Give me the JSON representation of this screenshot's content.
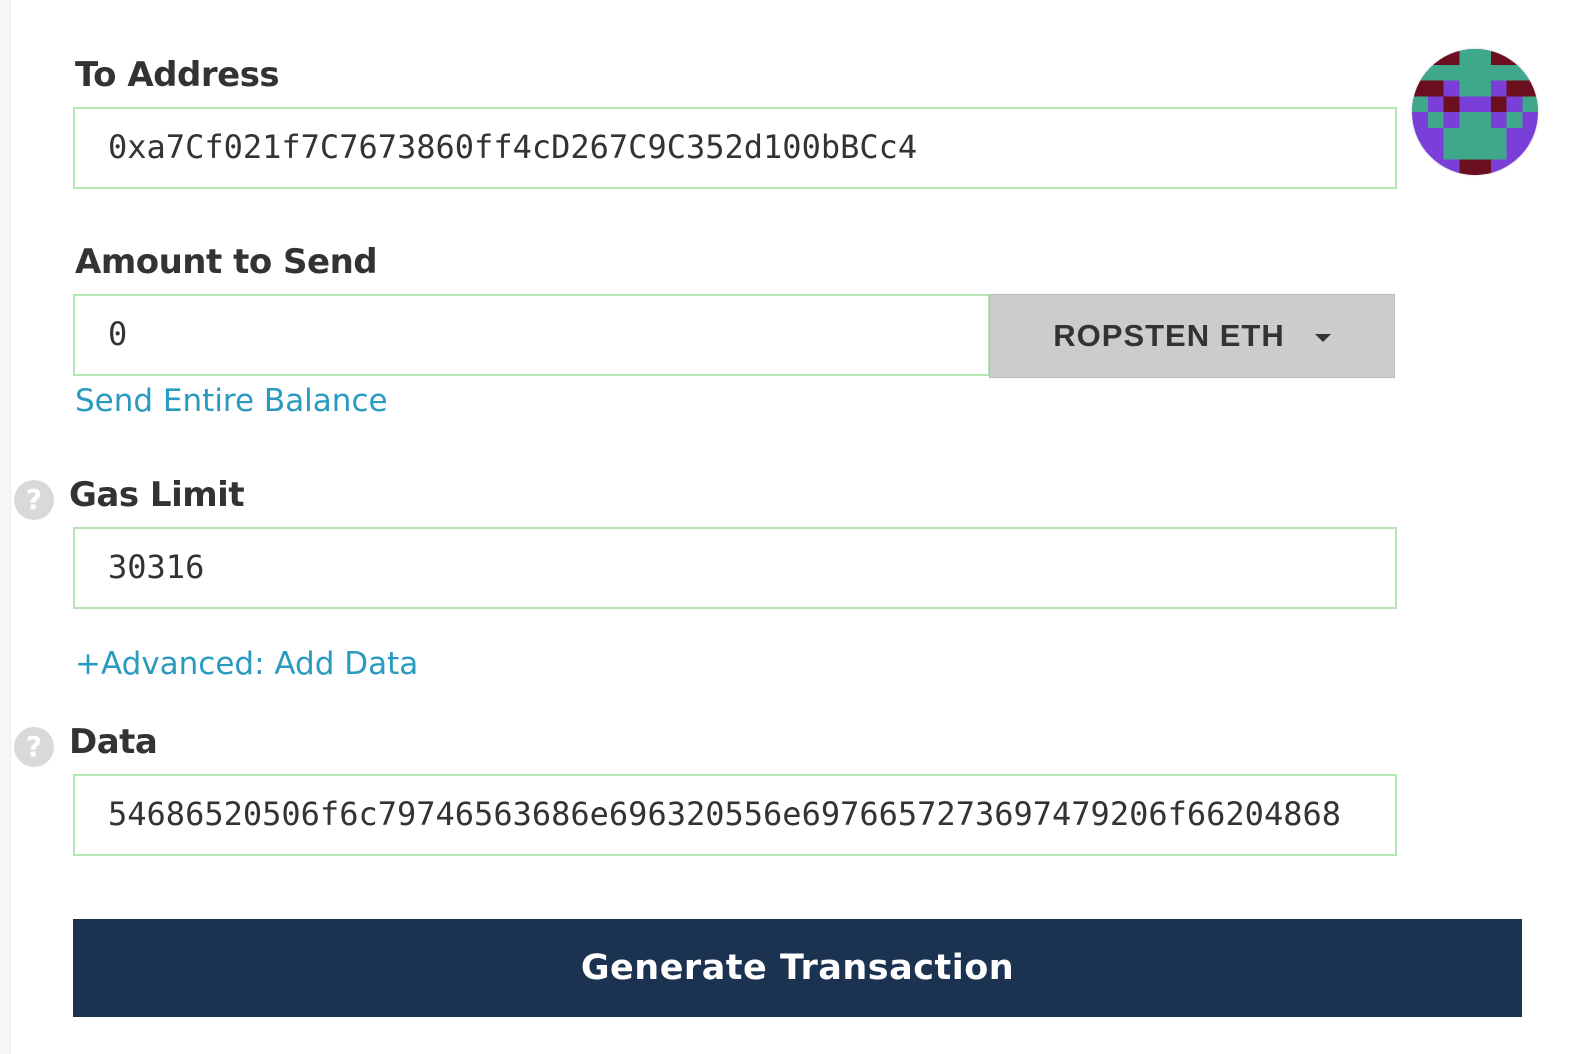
{
  "to_address": {
    "label": "To Address",
    "value": "0xa7Cf021f7C7673860ff4cD267C9C352d100bBCc4",
    "identicon": {
      "icon": "identicon",
      "colors": {
        "background": "#7a3fd9",
        "primary": "#3fa88a",
        "spot": "#6b0f1e"
      }
    }
  },
  "amount": {
    "label": "Amount to Send",
    "value": "0",
    "unit_selector": "ROPSTEN ETH",
    "send_entire_balance": "Send Entire Balance"
  },
  "gas_limit": {
    "label": "Gas Limit",
    "value": "30316",
    "help_icon": "?"
  },
  "advanced": {
    "link": "+Advanced: Add Data"
  },
  "data": {
    "label": "Data",
    "value": "54686520506f6c79746563686e696320556e6976657273697479206f66204868",
    "help_icon": "?"
  },
  "actions": {
    "generate": "Generate Transaction"
  },
  "colors": {
    "field_border": "#b4e6b4",
    "link": "#2a9bc0",
    "button_bg": "#1b3250",
    "dropdown_bg": "#cccccc"
  }
}
